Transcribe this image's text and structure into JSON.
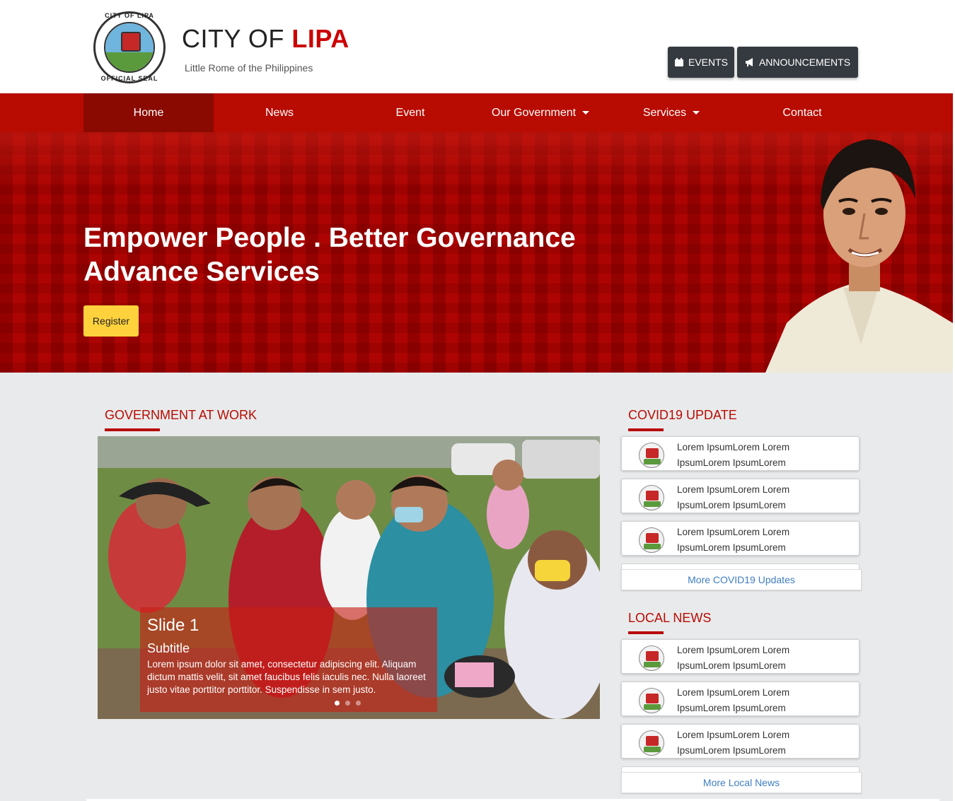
{
  "header": {
    "seal_top_text": "CITY OF LIPA",
    "seal_bottom_text": "OFFICIAL SEAL",
    "title_prefix": "CITY OF ",
    "title_accent": "LIPA",
    "tagline": "Little Rome of the Philippines",
    "events_button": "EVENTS",
    "events_icon": "calendar-icon",
    "announcements_button": "ANNOUNCEMENTS",
    "announcements_icon": "megaphone-icon"
  },
  "nav": {
    "items": [
      "Home",
      "News",
      "Event",
      "Our Government",
      "Services",
      "Contact"
    ],
    "active": "Home"
  },
  "hero": {
    "headline_line1": "Empower People . Better Governance",
    "headline_line2": "Advance Services",
    "register_button": "Register"
  },
  "government_at_work": {
    "title": "GOVERNMENT AT WORK",
    "slide": {
      "title": "Slide 1",
      "subtitle": "Subtitle",
      "text": "Lorem ipsum dolor sit amet, consectetur adipiscing elit. Aliquam dictum mattis velit, sit amet faucibus felis iaculis nec. Nulla laoreet justo vitae porttitor porttitor. Suspendisse in sem justo."
    }
  },
  "covid_update": {
    "title": "COVID19 UPDATE",
    "items": [
      {
        "line1": "Lorem IpsumLorem Lorem",
        "line2": "IpsumLorem IpsumLorem"
      },
      {
        "line1": "Lorem IpsumLorem Lorem",
        "line2": "IpsumLorem IpsumLorem"
      },
      {
        "line1": "Lorem IpsumLorem Lorem",
        "line2": "IpsumLorem IpsumLorem"
      }
    ],
    "more_link": "More COVID19 Updates"
  },
  "local_news": {
    "title": "LOCAL NEWS",
    "items": [
      {
        "line1": "Lorem IpsumLorem Lorem",
        "line2": "IpsumLorem IpsumLorem"
      },
      {
        "line1": "Lorem IpsumLorem Lorem",
        "line2": "IpsumLorem IpsumLorem"
      },
      {
        "line1": "Lorem IpsumLorem Lorem",
        "line2": "IpsumLorem IpsumLorem"
      }
    ],
    "more_link": "More Local News"
  },
  "colors": {
    "brand_red": "#b80b02",
    "nav_active": "#8a0a01",
    "register_yellow": "#ffd23d",
    "dark_button": "#353a40",
    "link_blue": "#3f7ec2"
  }
}
